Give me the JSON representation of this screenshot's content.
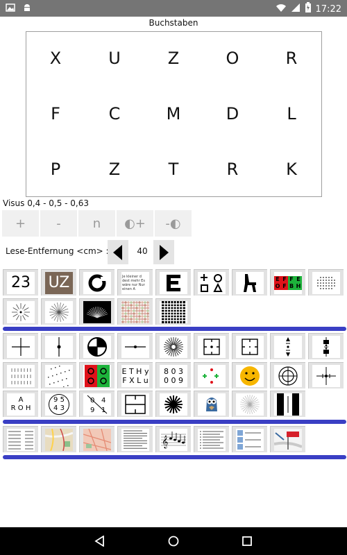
{
  "status": {
    "time": "17:22",
    "icons": [
      "image-icon",
      "android-icon",
      "wifi-icon",
      "signal-icon",
      "battery-icon"
    ]
  },
  "title": "Buchstaben",
  "letters": [
    [
      "X",
      "U",
      "Z",
      "O",
      "R"
    ],
    [
      "F",
      "C",
      "M",
      "D",
      "L"
    ],
    [
      "P",
      "Z",
      "T",
      "R",
      "K"
    ]
  ],
  "visus": "Visus 0,4 - 0,5 - 0,63",
  "controls": [
    {
      "label": "+",
      "name": "increase-button"
    },
    {
      "label": "-",
      "name": "decrease-button"
    },
    {
      "label": "n",
      "name": "n-button"
    },
    {
      "label": "◐+",
      "name": "contrast-up-button"
    },
    {
      "label": "-◐",
      "name": "contrast-down-button"
    }
  ],
  "distance": {
    "label": "Lese-Entfernung <cm> :",
    "value": "40"
  },
  "tiles_row1": [
    {
      "name": "tile-numbers",
      "text": "23"
    },
    {
      "name": "tile-letters-uz",
      "text": "UZ"
    },
    {
      "name": "tile-landolt-ring",
      "text": ""
    },
    {
      "name": "tile-reading-text",
      "text": "Je kleiner d dest mehr Es wäre nur Nur einen A"
    },
    {
      "name": "tile-tumbling-e",
      "text": "E"
    },
    {
      "name": "tile-shapes",
      "text": ""
    },
    {
      "name": "tile-chair",
      "text": ""
    },
    {
      "name": "tile-red-green-letters",
      "text": "E F F E O F B H"
    },
    {
      "name": "tile-dot-grid",
      "text": ""
    }
  ],
  "tiles_row2": [
    {
      "name": "tile-starburst-dots",
      "text": ""
    },
    {
      "name": "tile-starburst-lines",
      "text": ""
    },
    {
      "name": "tile-dark-fan",
      "text": ""
    },
    {
      "name": "tile-color-plate",
      "text": ""
    },
    {
      "name": "tile-amsler-grid",
      "text": ""
    }
  ],
  "tiles_row3": [
    {
      "name": "tile-cross",
      "text": ""
    },
    {
      "name": "tile-vertical-line",
      "text": ""
    },
    {
      "name": "tile-cross-circle",
      "text": ""
    },
    {
      "name": "tile-horizontal-line",
      "text": ""
    },
    {
      "name": "tile-radial-lines",
      "text": ""
    },
    {
      "name": "tile-square-dot",
      "text": ""
    },
    {
      "name": "tile-square-brackets",
      "text": ""
    },
    {
      "name": "tile-arrows-vertical",
      "text": ""
    },
    {
      "name": "tile-bar-arrows",
      "text": ""
    }
  ],
  "tiles_row4": [
    {
      "name": "tile-dashed-lines",
      "text": ""
    },
    {
      "name": "tile-noise",
      "text": ""
    },
    {
      "name": "tile-red-green-circles",
      "text": ""
    },
    {
      "name": "tile-letters-ethy",
      "text": "E T H y F X L u"
    },
    {
      "name": "tile-digits",
      "text": "8 0 3 0 0 9"
    },
    {
      "name": "tile-dots-color",
      "text": ""
    },
    {
      "name": "tile-smiley",
      "text": ""
    },
    {
      "name": "tile-target",
      "text": ""
    },
    {
      "name": "tile-fixation-cross",
      "text": ""
    }
  ],
  "tiles_row5": [
    {
      "name": "tile-letters-aroh",
      "text": "A R O H"
    },
    {
      "name": "tile-digit-circle",
      "text": "9 5 4 3"
    },
    {
      "name": "tile-digit-diagonal",
      "text": "0 4 9 1"
    },
    {
      "name": "tile-four-squares",
      "text": ""
    },
    {
      "name": "tile-asterisk",
      "text": ""
    },
    {
      "name": "tile-owl",
      "text": ""
    },
    {
      "name": "tile-thin-star",
      "text": ""
    },
    {
      "name": "tile-black-white-bars",
      "text": ""
    }
  ],
  "tiles_row6": [
    {
      "name": "tile-table-text",
      "text": ""
    },
    {
      "name": "tile-map",
      "text": "Südbad Laufen"
    },
    {
      "name": "tile-map-small",
      "text": ""
    },
    {
      "name": "tile-newspaper",
      "text": ""
    },
    {
      "name": "tile-music-notes",
      "text": ""
    },
    {
      "name": "tile-bullet-text",
      "text": ""
    },
    {
      "name": "tile-contacts",
      "text": ""
    },
    {
      "name": "tile-signpost",
      "text": ""
    }
  ]
}
